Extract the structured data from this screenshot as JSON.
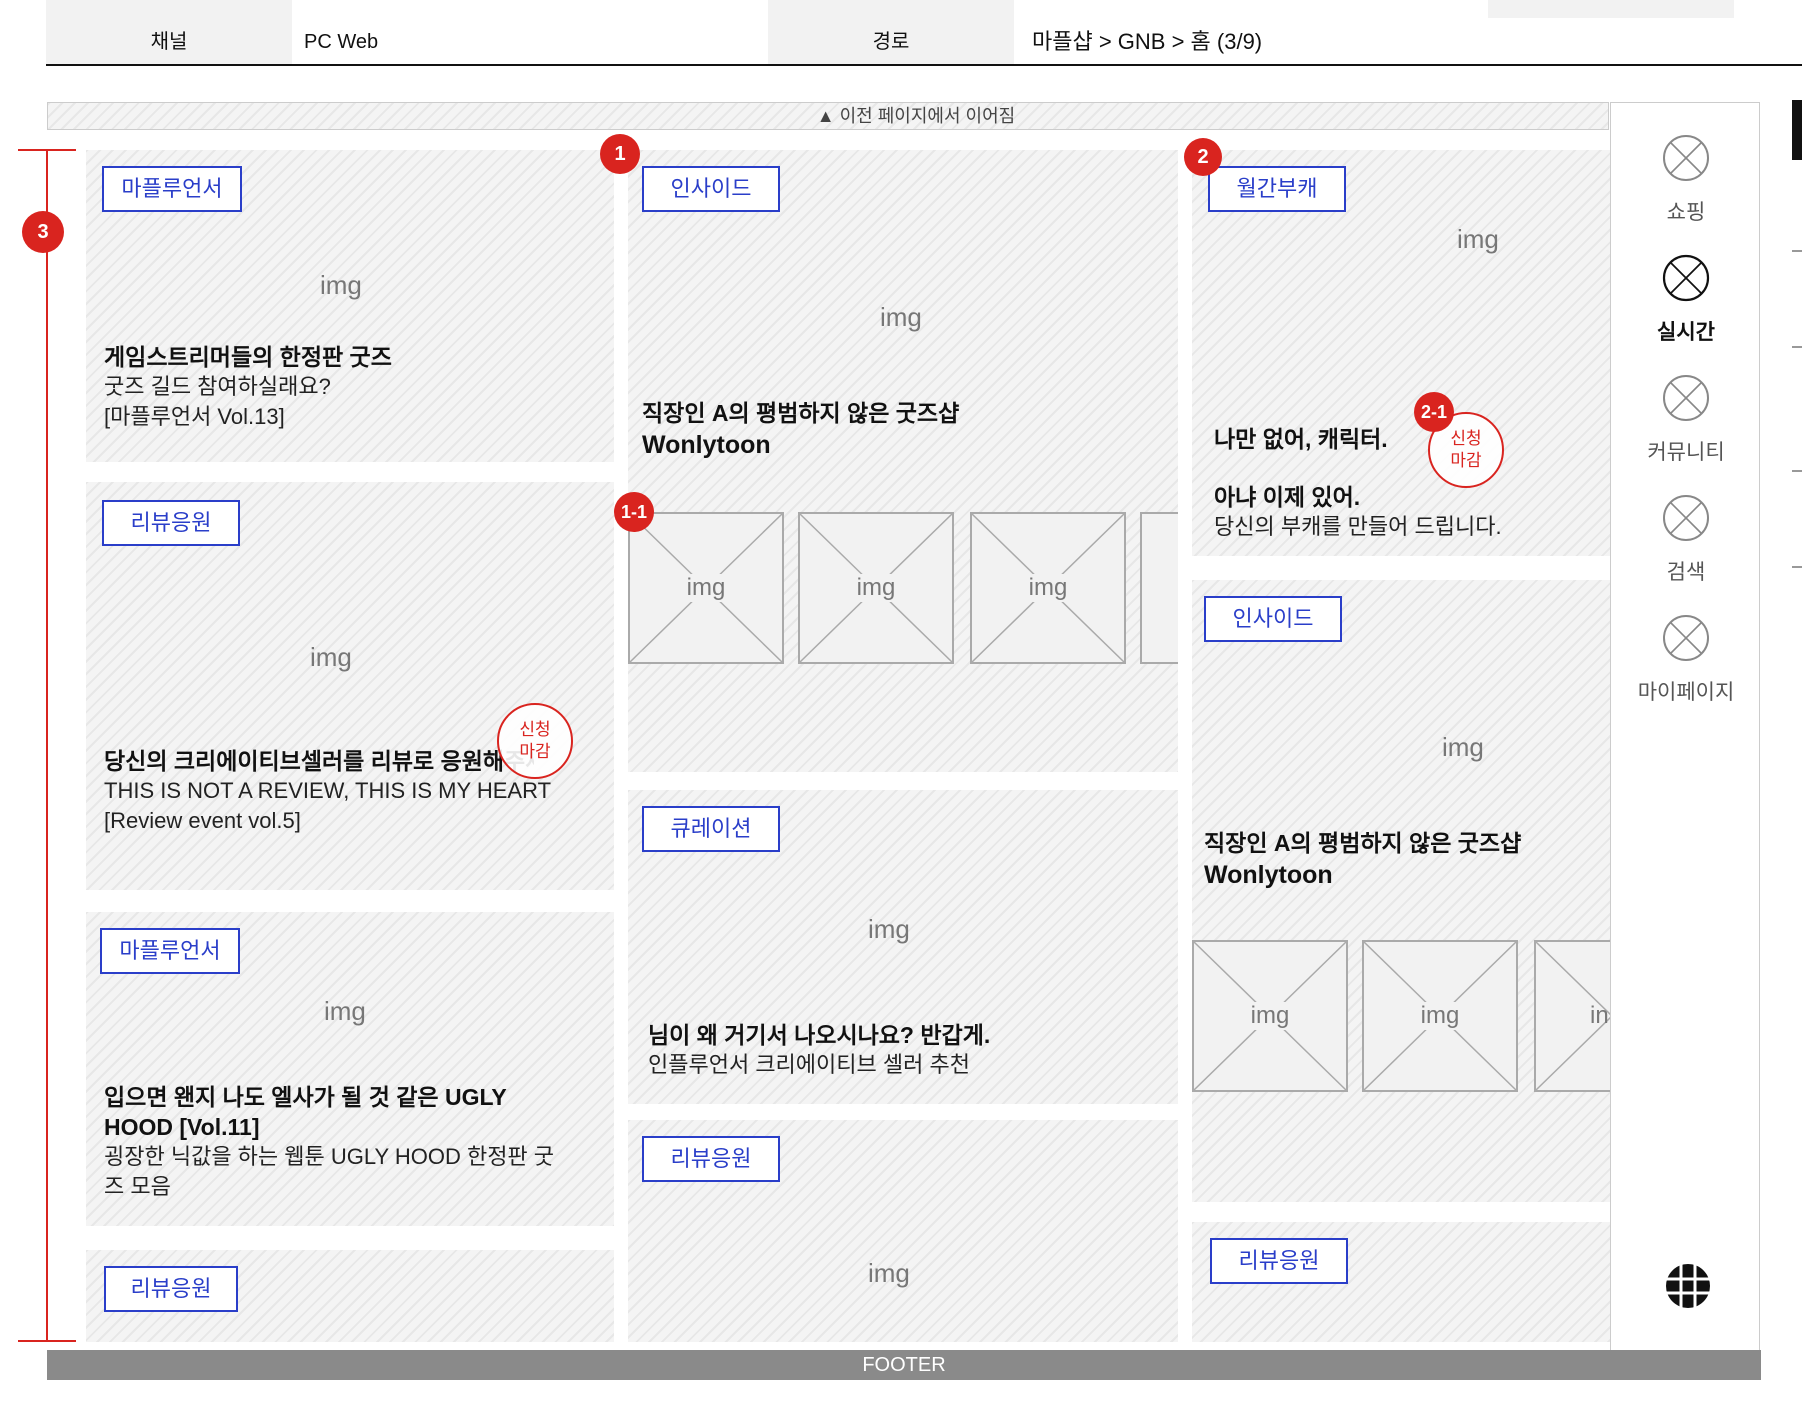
{
  "header": {
    "rows": [
      {
        "label1": "채널",
        "value1": "PC Web",
        "label2": "경로",
        "value2": "마플샵 > GNB > 홈 (3/9)"
      }
    ]
  },
  "canvas": {
    "top_notice": "▲ 이전 페이지에서 이어짐",
    "footer": "FOOTER"
  },
  "badges": {
    "b1": "1",
    "b1_1": "1-1",
    "b2": "2",
    "b2_1": "2-1",
    "b3": "3"
  },
  "stamp_text": [
    "신청",
    "마감"
  ],
  "columns": {
    "left": [
      {
        "tag": "마플루언서",
        "img": "img",
        "title": "게임스트리머들의 한정판 굿즈",
        "body": [
          "굿즈 길드 참여하실래요?",
          "[마플루언서 Vol.13]"
        ]
      },
      {
        "tag": "리뷰응원",
        "img": "img",
        "title": "당신의 크리에이티브셀러를 리뷰로 응원해주세요",
        "body": [
          "THIS IS NOT A REVIEW, THIS IS MY HEART",
          "[Review event vol.5]"
        ]
      },
      {
        "tag": "마플루언서",
        "img": "img",
        "title": [
          "입으면 왠지 나도 엘사가 될 것 같은 UGLY",
          "HOOD  [Vol.11]"
        ],
        "body": [
          "굉장한 닉값을 하는 웹툰 UGLY HOOD  한정판 굿",
          "즈 모음"
        ]
      },
      {
        "tag": "리뷰응원"
      }
    ],
    "middle": [
      {
        "tag": "인사이드",
        "img": "img",
        "title": [
          "직장인 A의 평범하지 않은 굿즈샵",
          "Wonlytoon"
        ],
        "thumbs": [
          "img",
          "img",
          "img"
        ]
      },
      {
        "tag": "큐레이션",
        "img": "img",
        "title": "님이 왜 거기서 나오시나요? 반갑게.",
        "body": [
          "인플루언서 크리에이티브 셀러 추천"
        ]
      },
      {
        "tag": "리뷰응원",
        "img": "img"
      }
    ],
    "right": [
      {
        "tag": "월간부캐",
        "img": "img",
        "title1": "나만 없어, 캐릭터.",
        "title2": "아냐 이제 있어.",
        "body": [
          "당신의 부캐를 만들어 드립니다."
        ]
      },
      {
        "tag": "인사이드",
        "img": "img",
        "title": [
          "직장인 A의 평범하지 않은 굿즈샵",
          "Wonlytoon"
        ],
        "thumbs": [
          "img",
          "img",
          "in"
        ]
      },
      {
        "tag": "리뷰응원"
      }
    ]
  },
  "side_nav": {
    "items": [
      {
        "label": "쇼핑",
        "icon": "placeholder-x-icon"
      },
      {
        "label": "실시간",
        "icon": "placeholder-x-icon",
        "active": true
      },
      {
        "label": "커뮤니티",
        "icon": "placeholder-x-icon"
      },
      {
        "label": "검색",
        "icon": "placeholder-x-icon"
      },
      {
        "label": "마이페이지",
        "icon": "placeholder-x-icon"
      }
    ],
    "bottom_icon": "grid-globe-icon"
  }
}
